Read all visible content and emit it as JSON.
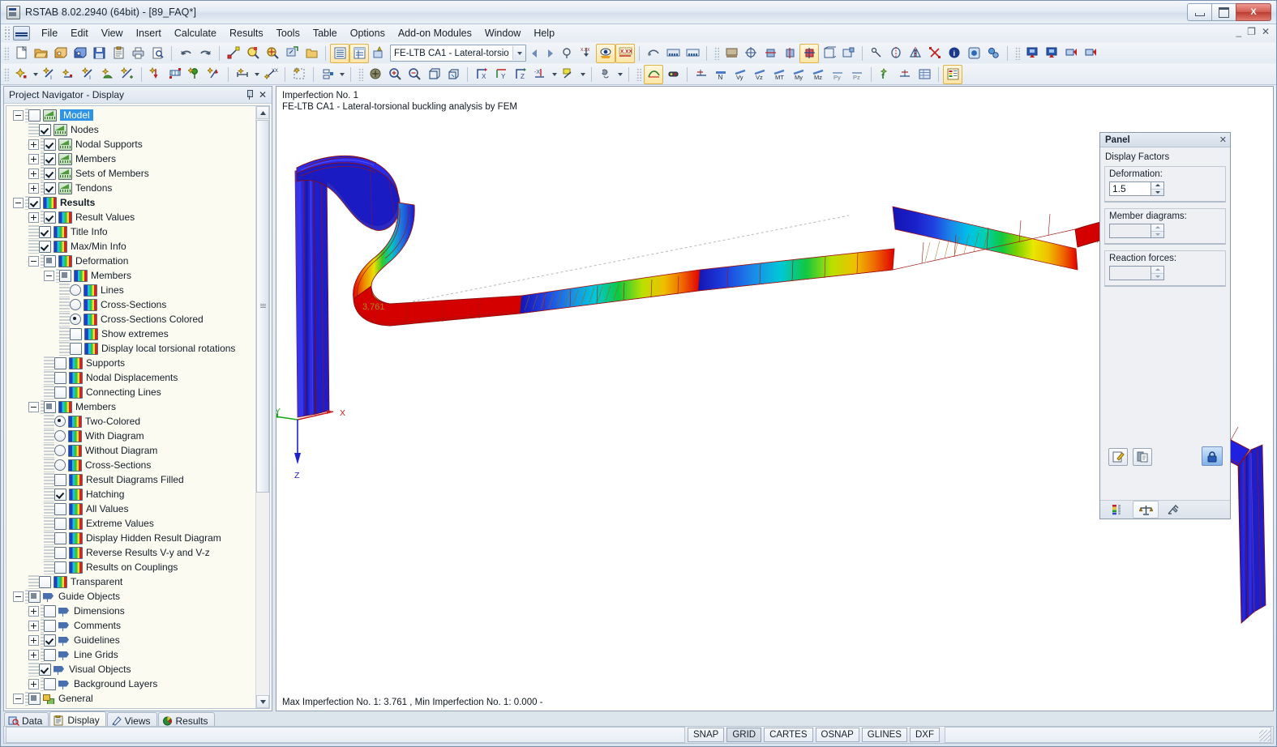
{
  "window": {
    "title": "RSTAB 8.02.2940 (64bit) - [89_FAQ*]",
    "min_label": "Minimize",
    "max_label": "Restore",
    "close_label": "X",
    "mdi_min": "_",
    "mdi_restore": "❐",
    "mdi_close": "✕"
  },
  "menu": [
    {
      "label": "File"
    },
    {
      "label": "Edit"
    },
    {
      "label": "View"
    },
    {
      "label": "Insert"
    },
    {
      "label": "Calculate"
    },
    {
      "label": "Results"
    },
    {
      "label": "Tools"
    },
    {
      "label": "Table"
    },
    {
      "label": "Options"
    },
    {
      "label": "Add-on Modules"
    },
    {
      "label": "Window"
    },
    {
      "label": "Help"
    }
  ],
  "toolbar": {
    "load_case_combo": "FE-LTB CA1 - Lateral-torsio",
    "xxx_label_1": "X.XX",
    "xxx_label_2": "X.XX",
    "result_labels": [
      "N",
      "Vy",
      "Vz",
      "MT",
      "My",
      "Mz",
      "Py",
      "Pz"
    ],
    "axis_labels": [
      "X",
      "Y",
      "Z",
      "-X"
    ]
  },
  "navigator": {
    "title": "Project Navigator - Display",
    "pin_label": "Auto Hide",
    "close_label": "✕",
    "tree": [
      {
        "depth": 0,
        "ctl": "check-none",
        "state": "empty",
        "expander": "minus",
        "icon": "green",
        "label": "Model",
        "selected": true,
        "bold": false
      },
      {
        "depth": 1,
        "ctl": "check",
        "state": "checked",
        "expander": "none",
        "icon": "green",
        "label": "Nodes"
      },
      {
        "depth": 1,
        "ctl": "check",
        "state": "checked",
        "expander": "plus",
        "icon": "green",
        "label": "Nodal Supports"
      },
      {
        "depth": 1,
        "ctl": "check",
        "state": "checked",
        "expander": "plus",
        "icon": "green",
        "label": "Members"
      },
      {
        "depth": 1,
        "ctl": "check",
        "state": "checked",
        "expander": "plus",
        "icon": "green",
        "label": "Sets of Members"
      },
      {
        "depth": 1,
        "ctl": "check",
        "state": "checked",
        "expander": "plus",
        "icon": "green",
        "label": "Tendons"
      },
      {
        "depth": 0,
        "ctl": "check",
        "state": "checked",
        "expander": "minus",
        "icon": "rainbow",
        "label": "Results",
        "bold": true
      },
      {
        "depth": 1,
        "ctl": "check",
        "state": "checked",
        "expander": "plus",
        "icon": "rainbow",
        "label": "Result Values"
      },
      {
        "depth": 1,
        "ctl": "check",
        "state": "checked",
        "expander": "none",
        "icon": "rainbow",
        "label": "Title Info"
      },
      {
        "depth": 1,
        "ctl": "check",
        "state": "checked",
        "expander": "none",
        "icon": "rainbow",
        "label": "Max/Min Info"
      },
      {
        "depth": 1,
        "ctl": "check",
        "state": "tri",
        "expander": "minus",
        "icon": "rainbow",
        "label": "Deformation"
      },
      {
        "depth": 2,
        "ctl": "check",
        "state": "tri",
        "expander": "minus",
        "icon": "rainbow",
        "label": "Members"
      },
      {
        "depth": 3,
        "ctl": "radio",
        "state": "off",
        "expander": "none",
        "icon": "rainbow",
        "label": "Lines"
      },
      {
        "depth": 3,
        "ctl": "radio",
        "state": "off",
        "expander": "none",
        "icon": "rainbow",
        "label": "Cross-Sections"
      },
      {
        "depth": 3,
        "ctl": "radio",
        "state": "on",
        "expander": "none",
        "icon": "rainbow",
        "label": "Cross-Sections Colored"
      },
      {
        "depth": 3,
        "ctl": "check",
        "state": "empty",
        "expander": "none",
        "icon": "rainbow",
        "label": "Show extremes"
      },
      {
        "depth": 3,
        "ctl": "check",
        "state": "empty",
        "expander": "none",
        "icon": "rainbow",
        "label": "Display local torsional rotations"
      },
      {
        "depth": 2,
        "ctl": "check",
        "state": "empty",
        "expander": "none",
        "icon": "rainbow",
        "label": "Supports"
      },
      {
        "depth": 2,
        "ctl": "check",
        "state": "empty",
        "expander": "none",
        "icon": "rainbow",
        "label": "Nodal Displacements"
      },
      {
        "depth": 2,
        "ctl": "check",
        "state": "empty",
        "expander": "none",
        "icon": "rainbow",
        "label": "Connecting Lines"
      },
      {
        "depth": 1,
        "ctl": "check",
        "state": "tri",
        "expander": "minus",
        "icon": "rainbow",
        "label": "Members"
      },
      {
        "depth": 2,
        "ctl": "radio",
        "state": "on",
        "expander": "none",
        "icon": "rainbow",
        "label": "Two-Colored"
      },
      {
        "depth": 2,
        "ctl": "radio",
        "state": "off",
        "expander": "none",
        "icon": "rainbow",
        "label": "With Diagram"
      },
      {
        "depth": 2,
        "ctl": "radio",
        "state": "off",
        "expander": "none",
        "icon": "rainbow",
        "label": "Without Diagram"
      },
      {
        "depth": 2,
        "ctl": "radio",
        "state": "off",
        "expander": "none",
        "icon": "rainbow",
        "label": "Cross-Sections"
      },
      {
        "depth": 2,
        "ctl": "check",
        "state": "empty",
        "expander": "none",
        "icon": "rainbow",
        "label": "Result Diagrams Filled"
      },
      {
        "depth": 2,
        "ctl": "check",
        "state": "checked",
        "expander": "none",
        "icon": "rainbow",
        "label": "Hatching"
      },
      {
        "depth": 2,
        "ctl": "check",
        "state": "empty",
        "expander": "none",
        "icon": "rainbow",
        "label": "All Values"
      },
      {
        "depth": 2,
        "ctl": "check",
        "state": "empty",
        "expander": "none",
        "icon": "rainbow",
        "label": "Extreme Values"
      },
      {
        "depth": 2,
        "ctl": "check",
        "state": "empty",
        "expander": "none",
        "icon": "rainbow",
        "label": "Display Hidden Result Diagram"
      },
      {
        "depth": 2,
        "ctl": "check",
        "state": "empty",
        "expander": "none",
        "icon": "rainbow",
        "label": "Reverse Results V-y and V-z"
      },
      {
        "depth": 2,
        "ctl": "check",
        "state": "empty",
        "expander": "none",
        "icon": "rainbow",
        "label": "Results on Couplings"
      },
      {
        "depth": 1,
        "ctl": "check",
        "state": "empty",
        "expander": "none",
        "icon": "rainbow",
        "label": "Transparent"
      },
      {
        "depth": 0,
        "ctl": "check",
        "state": "tri",
        "expander": "minus",
        "icon": "guide",
        "label": "Guide Objects"
      },
      {
        "depth": 1,
        "ctl": "check",
        "state": "empty",
        "expander": "plus",
        "icon": "guide",
        "label": "Dimensions"
      },
      {
        "depth": 1,
        "ctl": "check",
        "state": "empty",
        "expander": "plus",
        "icon": "guide",
        "label": "Comments"
      },
      {
        "depth": 1,
        "ctl": "check",
        "state": "checked",
        "expander": "plus",
        "icon": "guide",
        "label": "Guidelines"
      },
      {
        "depth": 1,
        "ctl": "check",
        "state": "empty",
        "expander": "plus",
        "icon": "guide",
        "label": "Line Grids"
      },
      {
        "depth": 1,
        "ctl": "check",
        "state": "checked",
        "expander": "none",
        "icon": "guide",
        "label": "Visual Objects"
      },
      {
        "depth": 1,
        "ctl": "check",
        "state": "empty",
        "expander": "plus",
        "icon": "guide",
        "label": "Background Layers"
      },
      {
        "depth": 0,
        "ctl": "check",
        "state": "tri",
        "expander": "minus",
        "icon": "gen",
        "label": "General"
      }
    ],
    "tabs": [
      {
        "label": "Data",
        "icon": "data-icon",
        "active": false
      },
      {
        "label": "Display",
        "icon": "display-icon",
        "active": true
      },
      {
        "label": "Views",
        "icon": "views-icon",
        "active": false
      },
      {
        "label": "Results",
        "icon": "results-icon",
        "active": false
      }
    ]
  },
  "viewport": {
    "title_line1": "Imperfection No. 1",
    "title_line2": "FE-LTB CA1 - Lateral-torsional buckling analysis by FEM",
    "max_value_label": "3.761",
    "axis_x": "X",
    "axis_y": "Y",
    "axis_z": "Z"
  },
  "panel": {
    "title": "Panel",
    "close_label": "✕",
    "section_title": "Display Factors",
    "deformation_label": "Deformation:",
    "deformation_value": "1.5",
    "member_diagrams_label": "Member diagrams:",
    "member_diagrams_value": "",
    "reaction_forces_label": "Reaction forces:",
    "reaction_forces_value": "",
    "tool_edit": "edit-icon",
    "tool_copy": "copy-icon",
    "tool_lock": "lock-icon",
    "tabs": [
      "color-scale-tab",
      "factors-tab",
      "filter-tab"
    ]
  },
  "status": {
    "max_min_text": "Max Imperfection No. 1: 3.761 , Min Imperfection No. 1: 0.000 -",
    "cells": [
      {
        "label": "SNAP",
        "pressed": false
      },
      {
        "label": "GRID",
        "pressed": true
      },
      {
        "label": "CARTES",
        "pressed": false
      },
      {
        "label": "OSNAP",
        "pressed": false
      },
      {
        "label": "GLINES",
        "pressed": false
      },
      {
        "label": "DXF",
        "pressed": false
      }
    ]
  },
  "colors": {
    "accent": "#3094e6",
    "max_red": "#e00000",
    "min_blue": "#1a1ad0",
    "axis_x": "#cc2020",
    "axis_y": "#1aa81a",
    "axis_z": "#2020cc"
  }
}
